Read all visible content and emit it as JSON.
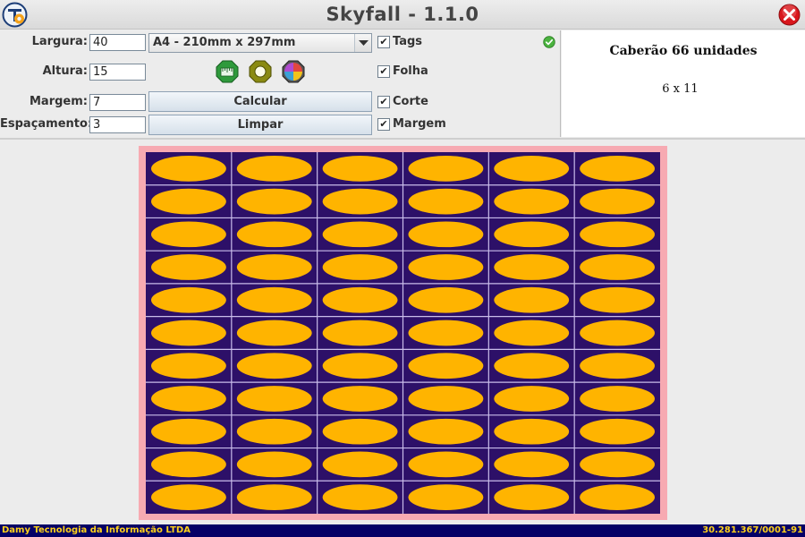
{
  "window": {
    "title": "Skyfall - 1.1.0"
  },
  "form": {
    "largura_label": "Largura:",
    "largura_value": "40",
    "altura_label": "Altura:",
    "altura_value": "15",
    "margem_label": "Margem:",
    "margem_value": "7",
    "espacamento_label": "Espaçamento:",
    "espacamento_value": "3",
    "paper_size": "A4 - 210mm x 297mm",
    "calcular_label": "Calcular",
    "limpar_label": "Limpar"
  },
  "checkboxes": [
    {
      "label": "Tags",
      "checked": true,
      "mark": "✔"
    },
    {
      "label": "Folha",
      "checked": true,
      "mark": "✔"
    },
    {
      "label": "Corte",
      "checked": true,
      "mark": "✔"
    },
    {
      "label": "Margem",
      "checked": true,
      "mark": "✔"
    }
  ],
  "icons": [
    "app-logo-icon",
    "close-icon",
    "dropdown-arrow-icon",
    "ruler-icon",
    "circle-shape-icon",
    "color-wheel-icon",
    "check-ok-icon"
  ],
  "result": {
    "title": "Caberão 66 unidades",
    "grid_text": "6 x 11"
  },
  "sheet": {
    "columns": 6,
    "rows": 11,
    "margin_color": "#f7aab2",
    "background_color": "#2d1068",
    "tag_color": "#ffb400",
    "cut_line_color": "#c9bcea"
  },
  "status": {
    "company": "Damy Tecnologia da Informação LTDA",
    "cnpj": "30.281.367/0001-91"
  },
  "colors": {
    "status_bg": "#050066",
    "status_text": "#ffd21a",
    "close_red": "#d9161c"
  }
}
